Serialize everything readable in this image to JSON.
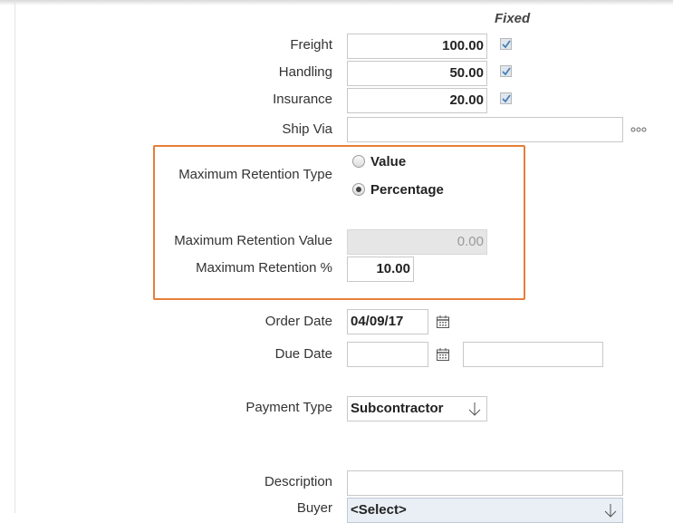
{
  "fixed_header": "Fixed",
  "charges": [
    {
      "label": "Freight",
      "value": "100.00",
      "fixed": true
    },
    {
      "label": "Handling",
      "value": "50.00",
      "fixed": true
    },
    {
      "label": "Insurance",
      "value": "20.00",
      "fixed": true
    }
  ],
  "ship_via": {
    "label": "Ship Via",
    "value": "",
    "more_icon": "ellipsis-icon"
  },
  "retention": {
    "type_label": "Maximum Retention Type",
    "options": [
      {
        "label": "Value",
        "selected": false
      },
      {
        "label": "Percentage",
        "selected": true
      }
    ],
    "value_label": "Maximum Retention Value",
    "value": "0.00",
    "percent_label": "Maximum Retention %",
    "percent": "10.00",
    "highlight_color": "#e67e3a"
  },
  "order_date": {
    "label": "Order Date",
    "value": "04/09/17",
    "icon": "calendar-icon"
  },
  "due_date": {
    "label": "Due Date",
    "value": "",
    "time_value": "",
    "icon": "calendar-icon"
  },
  "payment_type": {
    "label": "Payment Type",
    "value": "Subcontractor",
    "icon": "arrow-down-icon"
  },
  "description": {
    "label": "Description",
    "value": ""
  },
  "buyer": {
    "label": "Buyer",
    "value": "<Select>"
  }
}
